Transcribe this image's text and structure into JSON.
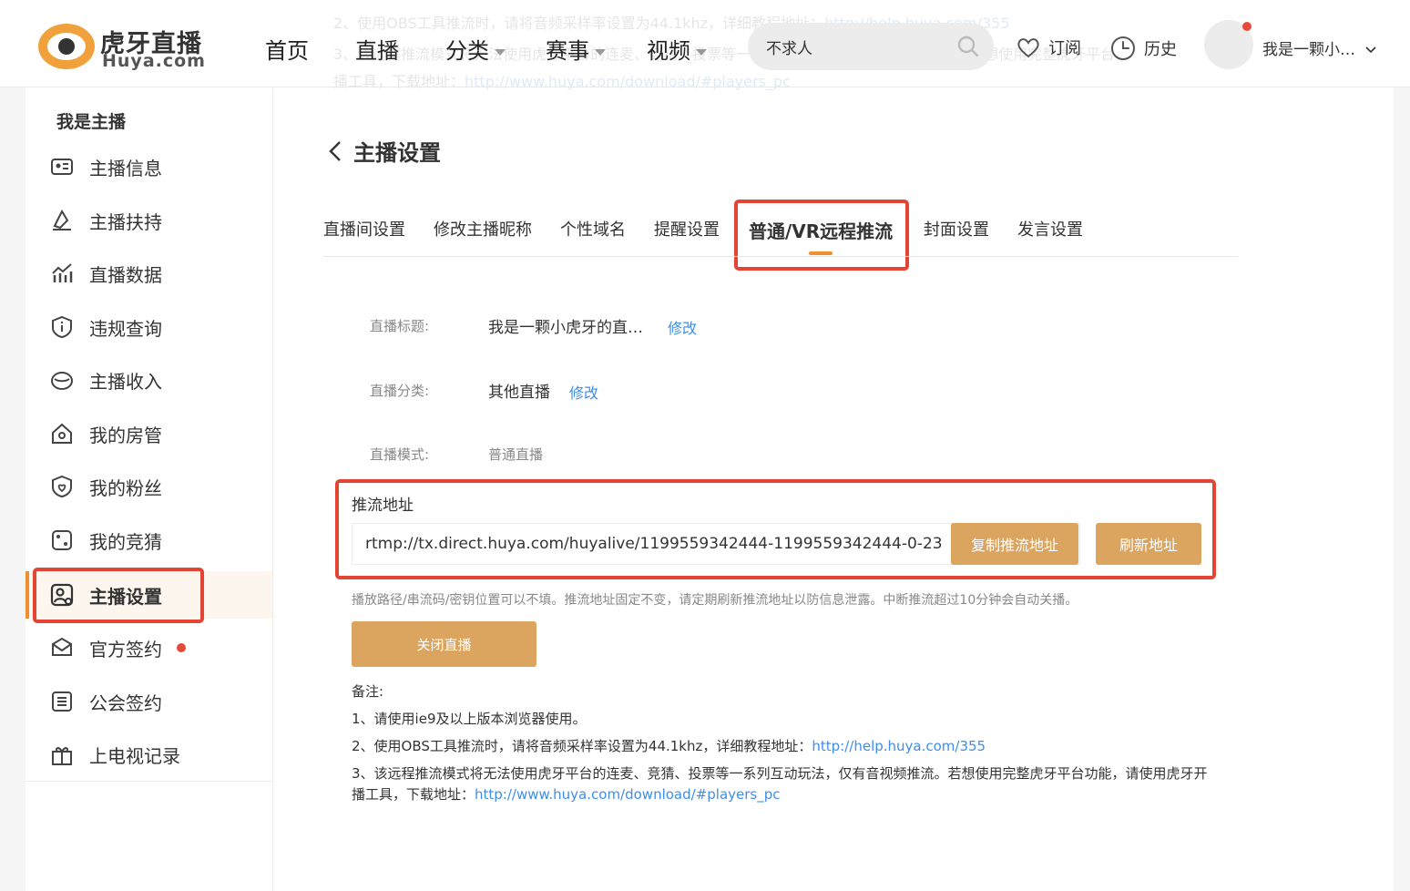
{
  "header": {
    "logo_cn": "虎牙直播",
    "logo_en": "Huya.com",
    "nav": [
      {
        "label": "首页",
        "dropdown": false
      },
      {
        "label": "直播",
        "dropdown": false
      },
      {
        "label": "分类",
        "dropdown": true
      },
      {
        "label": "赛事",
        "dropdown": true
      },
      {
        "label": "视频",
        "dropdown": true
      }
    ],
    "search_value": "不求人",
    "subscribe_label": "订阅",
    "history_label": "历史",
    "username": "我是一颗小…",
    "ghost_line1": "2、使用OBS工具推流时，请将音频采样率设置为44.1khz，详细教程地址：",
    "ghost_link1": "http://help.huya.com/355",
    "ghost_line2": "3、该远程推流模式将无法使用虎牙平台的连麦、竞猜、投票等一系列互动玩法，仅有音视频推流。若想使用完整虎牙平台",
    "ghost_line3": "播工具，下载地址：",
    "ghost_link3": "http://www.huya.com/download/#players_pc"
  },
  "sidebar": {
    "title": "我是主播",
    "items": [
      {
        "label": "主播信息",
        "icon": "id-card-icon"
      },
      {
        "label": "主播扶持",
        "icon": "support-icon"
      },
      {
        "label": "直播数据",
        "icon": "stats-icon"
      },
      {
        "label": "违规查询",
        "icon": "info-shield-icon"
      },
      {
        "label": "主播收入",
        "icon": "income-icon"
      },
      {
        "label": "我的房管",
        "icon": "house-icon"
      },
      {
        "label": "我的粉丝",
        "icon": "fans-icon"
      },
      {
        "label": "我的竞猜",
        "icon": "dice-icon"
      },
      {
        "label": "主播设置",
        "icon": "settings-user-icon",
        "active": true
      },
      {
        "label": "官方签约",
        "icon": "contract-icon",
        "badge": true
      },
      {
        "label": "公会签约",
        "icon": "guild-icon"
      },
      {
        "label": "上电视记录",
        "icon": "gift-icon"
      }
    ]
  },
  "main": {
    "page_title": "主播设置",
    "tabs": [
      {
        "label": "直播间设置"
      },
      {
        "label": "修改主播昵称"
      },
      {
        "label": "个性域名"
      },
      {
        "label": "提醒设置"
      },
      {
        "label": "普通/VR远程推流",
        "active": true
      },
      {
        "label": "封面设置"
      },
      {
        "label": "发言设置"
      }
    ],
    "fields": {
      "title_label": "直播标题:",
      "title_value": "我是一颗小虎牙的直…",
      "title_edit": "修改",
      "category_label": "直播分类:",
      "category_value": "其他直播",
      "category_edit": "修改",
      "mode_label": "直播模式:",
      "mode_value": "普通直播"
    },
    "stream": {
      "label": "推流地址",
      "url": "rtmp://tx.direct.huya.com/huyalive/1199559342444-1199559342444-0-23",
      "copy_button": "复制推流地址",
      "refresh_button": "刷新地址"
    },
    "hint": "播放路径/串流码/密钥位置可以不填。推流地址固定不变，请定期刷新推流地址以防信息泄露。中断推流超过10分钟会自动关播。",
    "close_button": "关闭直播",
    "notes": {
      "title": "备注:",
      "line1": "1、请使用ie9及以上版本浏览器使用。",
      "line2": "2、使用OBS工具推流时，请将音频采样率设置为44.1khz，详细教程地址：",
      "line2_link": "http://help.huya.com/355",
      "line3": "3、该远程推流模式将无法使用虎牙平台的连麦、竞猜、投票等一系列互动玩法，仅有音视频推流。若想使用完整虎牙平台功能，请使用虎牙开",
      "line4": "播工具，下载地址：",
      "line4_link": "http://www.huya.com/download/#players_pc"
    }
  },
  "colors": {
    "accent": "#dba45f",
    "highlight_border": "#e34434",
    "link": "#3e8ee8",
    "active_bar": "#f08f2e"
  }
}
